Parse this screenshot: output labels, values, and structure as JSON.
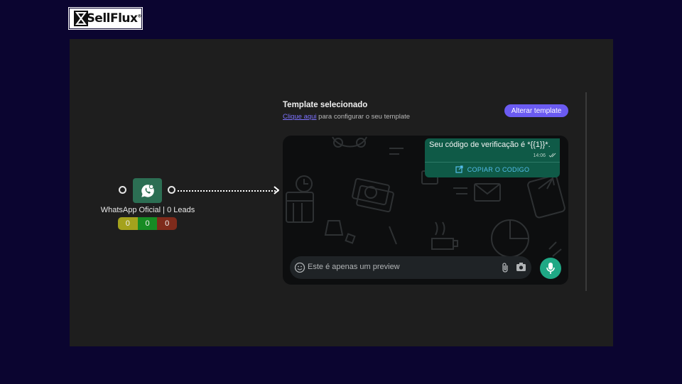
{
  "brand": {
    "name": "SellFlux",
    "registered": "®",
    "logo_icon": "hourglass-icon"
  },
  "node": {
    "label": "WhatsApp Oficial | 0 Leads",
    "icon": "whatsapp-icon",
    "counters": {
      "yellow": "0",
      "green": "0",
      "red": "0"
    },
    "colors": {
      "node_bg": "#2c6e53",
      "yellow": "#a4a21d",
      "green": "#178b24",
      "red": "#7f2b1b"
    }
  },
  "template": {
    "title": "Template selecionado",
    "link_text": "Clique aqui",
    "subtitle_rest": " para configurar o seu template",
    "alter_button": "Alterar template",
    "accent": "#6b5bf2"
  },
  "preview": {
    "message": "Seu código de verificação é *{{1}}*.",
    "time": "14:06",
    "copy_button": "COPIAR O CODIGO",
    "input_placeholder": "Este é apenas um preview",
    "bubble_color": "#0f5a47",
    "mic_color": "#1fa885"
  }
}
